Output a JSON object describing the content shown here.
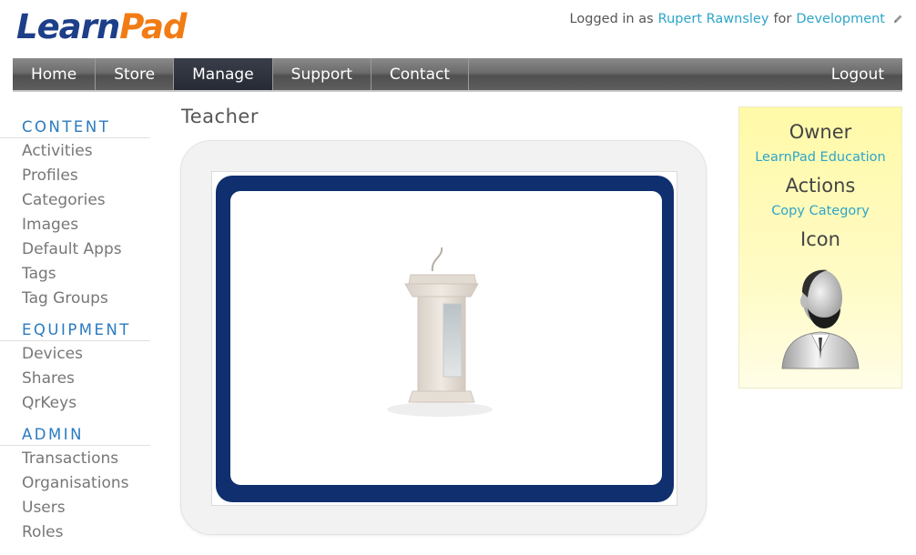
{
  "header": {
    "logo_part1": "Learn",
    "logo_part2": "Pad",
    "logged_in_prefix": "Logged in as",
    "user_name": "Rupert Rawnsley",
    "for_text": "for",
    "organisation": "Development"
  },
  "nav": {
    "items": [
      {
        "label": "Home"
      },
      {
        "label": "Store"
      },
      {
        "label": "Manage"
      },
      {
        "label": "Support"
      },
      {
        "label": "Contact"
      }
    ],
    "active": "Manage",
    "logout": "Logout"
  },
  "sidebar": {
    "sections": [
      {
        "title": "CONTENT",
        "items": [
          "Activities",
          "Profiles",
          "Categories",
          "Images",
          "Default Apps",
          "Tags",
          "Tag Groups"
        ]
      },
      {
        "title": "EQUIPMENT",
        "items": [
          "Devices",
          "Shares",
          "QrKeys"
        ]
      },
      {
        "title": "ADMIN",
        "items": [
          "Transactions",
          "Organisations",
          "Users",
          "Roles"
        ]
      }
    ]
  },
  "main": {
    "title": "Teacher"
  },
  "panel": {
    "owner_heading": "Owner",
    "owner_link": "LearnPad Education",
    "actions_heading": "Actions",
    "copy_link": "Copy Category",
    "icon_heading": "Icon"
  },
  "colors": {
    "brand_blue": "#1d3f8a",
    "brand_orange": "#f27c14",
    "link": "#2ea5c9",
    "section_title": "#2a7ac0",
    "tablet_frame": "#0f2f6e",
    "panel_bg": "#fff9a8"
  },
  "icons": {
    "edit": "pencil-icon",
    "category_image": "podium-image",
    "category_icon": "teacher-avatar-icon"
  }
}
